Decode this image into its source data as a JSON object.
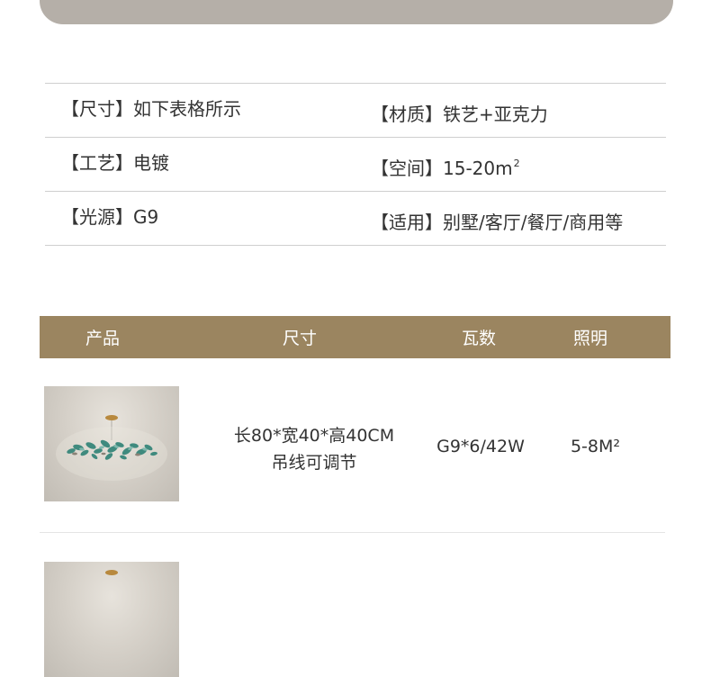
{
  "specs": [
    {
      "left": "【尺寸】如下表格所示",
      "right": "【材质】铁艺+亚克力",
      "right_sup": ""
    },
    {
      "left": "【工艺】电镀",
      "right": "【空间】15-20m",
      "right_sup": "2"
    },
    {
      "left": "【光源】G9",
      "right": "【适用】别墅/客厅/餐厅/商用等",
      "right_sup": ""
    }
  ],
  "table": {
    "headers": [
      "产品",
      "尺寸",
      "瓦数",
      "照明"
    ],
    "header_color": "#9b8560",
    "rows": [
      {
        "image": "chandelier-image",
        "size_line1": "长80*宽40*高40CM",
        "size_line2": "吊线可调节",
        "wattage": "G9*6/42W",
        "lighting": "5-8M²"
      },
      {
        "image": "chandelier-image"
      }
    ]
  },
  "colors": {
    "banner": "#b5afa8",
    "accent_teal": "#3f8a7e"
  }
}
